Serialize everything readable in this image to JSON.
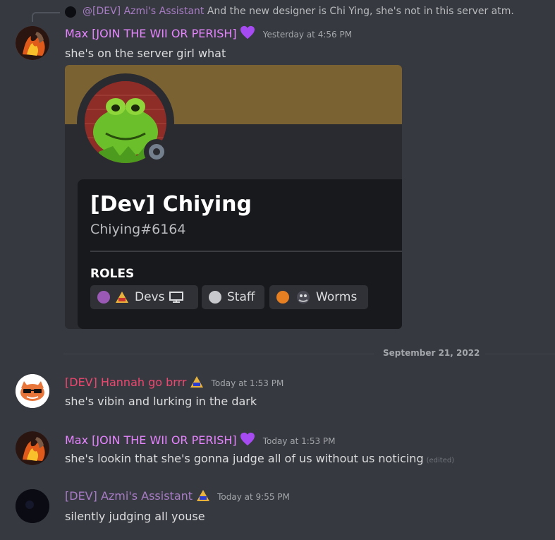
{
  "colors": {
    "background": "#36393f",
    "max_name": "#e685ff",
    "hannah_name": "#f04770",
    "assistant_name": "#a77cc4",
    "heart": "#a64bf2"
  },
  "reply": {
    "author": "@[DEV] Azmi's Assistant",
    "text": "And the new designer is Chi Ying, she's not in this server atm."
  },
  "messages": [
    {
      "author": "Max [JOIN THE WII OR PERISH]",
      "badge_icon": "purple-heart-icon",
      "timestamp": "Yesterday at 4:56 PM",
      "text": "she's on the server girl what"
    },
    {
      "author": "[DEV] Hannah go brrr",
      "badge_icon": "dev-triangle-icon",
      "timestamp": "Today at 1:53 PM",
      "text": "she's vibin and lurking in the dark"
    },
    {
      "author": "Max [JOIN THE WII OR PERISH]",
      "badge_icon": "purple-heart-icon",
      "timestamp": "Today at 1:53 PM",
      "text": "she's lookin that she's gonna judge all of us without us noticing",
      "edited": "(edited)"
    },
    {
      "author": "[DEV] Azmi's Assistant",
      "badge_icon": "dev-triangle-icon",
      "timestamp": "Today at 9:55 PM",
      "text": "silently judging all youse"
    }
  ],
  "embed": {
    "display_name": "[Dev] Chiying",
    "tag": "Chiying#6164",
    "roles_heading": "ROLES",
    "roles": [
      {
        "label": "Devs",
        "color": "#9b59b6"
      },
      {
        "label": "Staff",
        "color": "#c8c9cc"
      },
      {
        "label": "Worms",
        "color": "#e67e22"
      }
    ]
  },
  "date_divider": "September 21, 2022"
}
